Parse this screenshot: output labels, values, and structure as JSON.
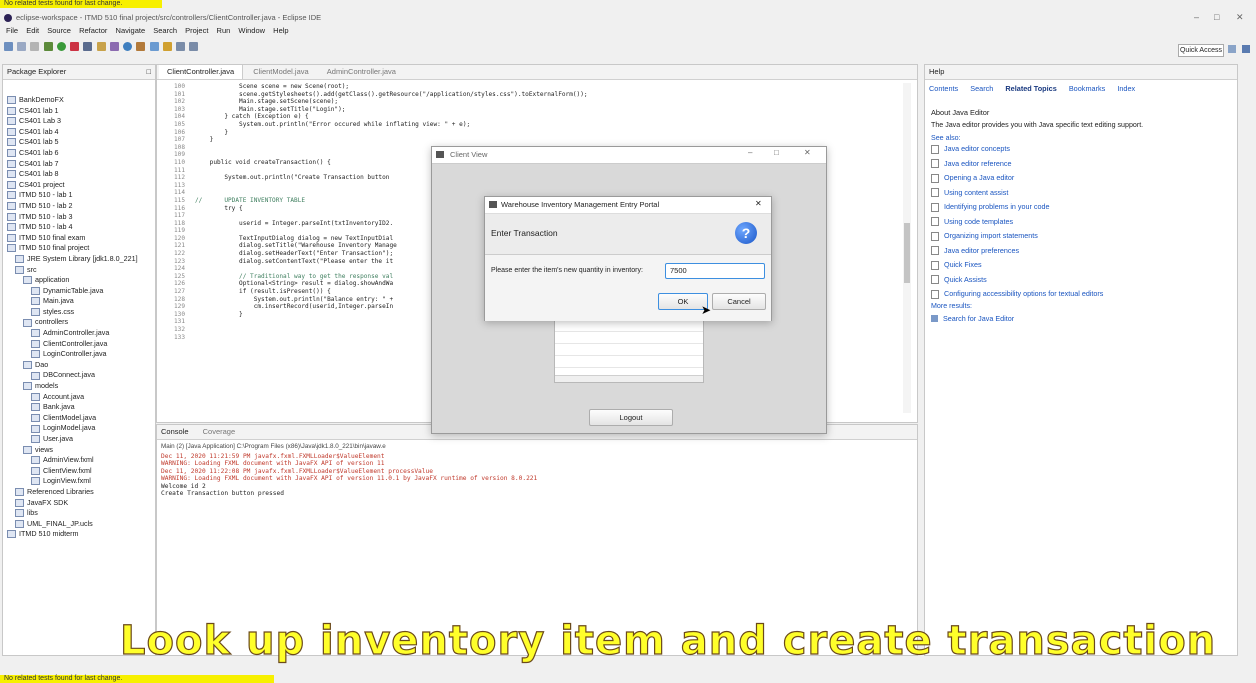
{
  "top_status": "No related tests found for last change.",
  "bottom_status": "No related tests found for last change.",
  "window_title": "eclipse-workspace - ITMD 510 final project/src/controllers/ClientController.java - Eclipse IDE",
  "menu": [
    "File",
    "Edit",
    "Source",
    "Refactor",
    "Navigate",
    "Search",
    "Project",
    "Run",
    "Window",
    "Help"
  ],
  "quick_access": "Quick Access",
  "package_explorer": {
    "title": "Package Explorer",
    "items": [
      {
        "label": "BankDemoFX",
        "indent": 0
      },
      {
        "label": "CS401 lab 1",
        "indent": 0
      },
      {
        "label": "CS401 Lab 3",
        "indent": 0
      },
      {
        "label": "CS401 lab 4",
        "indent": 0
      },
      {
        "label": "CS401 lab 5",
        "indent": 0
      },
      {
        "label": "CS401 lab 6",
        "indent": 0
      },
      {
        "label": "CS401 lab 7",
        "indent": 0
      },
      {
        "label": "CS401 lab 8",
        "indent": 0
      },
      {
        "label": "CS401 project",
        "indent": 0
      },
      {
        "label": "ITMD 510 - lab 1",
        "indent": 0
      },
      {
        "label": "ITMD 510 - lab 2",
        "indent": 0
      },
      {
        "label": "ITMD 510 - lab 3",
        "indent": 0
      },
      {
        "label": "ITMD 510 - lab 4",
        "indent": 0
      },
      {
        "label": "ITMD 510 final exam",
        "indent": 0
      },
      {
        "label": "ITMD 510 final project",
        "indent": 0
      },
      {
        "label": "JRE System Library [jdk1.8.0_221]",
        "indent": 1
      },
      {
        "label": "src",
        "indent": 1
      },
      {
        "label": "application",
        "indent": 2
      },
      {
        "label": "DynamicTable.java",
        "indent": 3
      },
      {
        "label": "Main.java",
        "indent": 3
      },
      {
        "label": "styles.css",
        "indent": 3
      },
      {
        "label": "controllers",
        "indent": 2
      },
      {
        "label": "AdminController.java",
        "indent": 3
      },
      {
        "label": "ClientController.java",
        "indent": 3
      },
      {
        "label": "LoginController.java",
        "indent": 3
      },
      {
        "label": "Dao",
        "indent": 2
      },
      {
        "label": "DBConnect.java",
        "indent": 3
      },
      {
        "label": "models",
        "indent": 2
      },
      {
        "label": "Account.java",
        "indent": 3
      },
      {
        "label": "Bank.java",
        "indent": 3
      },
      {
        "label": "ClientModel.java",
        "indent": 3
      },
      {
        "label": "LoginModel.java",
        "indent": 3
      },
      {
        "label": "User.java",
        "indent": 3
      },
      {
        "label": "views",
        "indent": 2
      },
      {
        "label": "AdminView.fxml",
        "indent": 3
      },
      {
        "label": "ClientView.fxml",
        "indent": 3
      },
      {
        "label": "LoginView.fxml",
        "indent": 3
      },
      {
        "label": "Referenced Libraries",
        "indent": 1
      },
      {
        "label": "JavaFX SDK",
        "indent": 1
      },
      {
        "label": "libs",
        "indent": 1
      },
      {
        "label": "UML_FINAL_JP.ucls",
        "indent": 1
      },
      {
        "label": "ITMD 510 midterm",
        "indent": 0
      }
    ]
  },
  "editor_tabs": [
    "ClientController.java",
    "ClientModel.java",
    "AdminController.java"
  ],
  "code_lines": [
    {
      "n": "100",
      "t": "            Scene scene = new Scene(root);"
    },
    {
      "n": "101",
      "t": "            scene.getStylesheets().add(getClass().getResource(\"/application/styles.css\").toExternalForm());"
    },
    {
      "n": "102",
      "t": "            Main.stage.setScene(scene);"
    },
    {
      "n": "103",
      "t": "            Main.stage.setTitle(\"Login\");"
    },
    {
      "n": "104",
      "t": "        } catch (Exception e) {"
    },
    {
      "n": "105",
      "t": "            System.out.println(\"Error occured while inflating view: \" + e);"
    },
    {
      "n": "106",
      "t": "        }"
    },
    {
      "n": "107",
      "t": "    }"
    },
    {
      "n": "108",
      "t": ""
    },
    {
      "n": "109",
      "t": ""
    },
    {
      "n": "110",
      "t": "    public void createTransaction() {"
    },
    {
      "n": "111",
      "t": ""
    },
    {
      "n": "112",
      "t": "        System.out.println(\"Create Transaction button"
    },
    {
      "n": "113",
      "t": ""
    },
    {
      "n": "114",
      "t": ""
    },
    {
      "n": "115",
      "t": "//      UPDATE INVENTORY TABLE"
    },
    {
      "n": "116",
      "t": "        try {"
    },
    {
      "n": "117",
      "t": ""
    },
    {
      "n": "118",
      "t": "            userid = Integer.parseInt(txtInventoryID2."
    },
    {
      "n": "119",
      "t": ""
    },
    {
      "n": "120",
      "t": "            TextInputDialog dialog = new TextInputDial"
    },
    {
      "n": "121",
      "t": "            dialog.setTitle(\"Warehouse Inventory Manage"
    },
    {
      "n": "122",
      "t": "            dialog.setHeaderText(\"Enter Transaction\");"
    },
    {
      "n": "123",
      "t": "            dialog.setContentText(\"Please enter the it"
    },
    {
      "n": "124",
      "t": ""
    },
    {
      "n": "125",
      "t": "            // Traditional way to get the response val"
    },
    {
      "n": "126",
      "t": "            Optional<String> result = dialog.showAndWa"
    },
    {
      "n": "127",
      "t": "            if (result.isPresent()) {"
    },
    {
      "n": "128",
      "t": "                System.out.println(\"Balance entry: \" +"
    },
    {
      "n": "129",
      "t": "                cm.insertRecord(userid,Integer.parseIn"
    },
    {
      "n": "130",
      "t": "            }"
    },
    {
      "n": "131",
      "t": ""
    },
    {
      "n": "132",
      "t": ""
    },
    {
      "n": "133",
      "t": ""
    }
  ],
  "console": {
    "tabs": [
      "Console",
      "Coverage"
    ],
    "header": "Main (2) [Java Application] C:\\Program Files (x86)\\Java\\jdk1.8.0_221\\bin\\javaw.e",
    "lines": [
      {
        "t": "Dec 11, 2020 11:21:59 PM javafx.fxml.FXMLLoader$ValueElement",
        "c": "#c0392b"
      },
      {
        "t": "WARNING: Loading FXML document with JavaFX API of version 11",
        "c": "#c0392b"
      },
      {
        "t": "Dec 11, 2020 11:22:08 PM javafx.fxml.FXMLLoader$ValueElement processValue",
        "c": "#c0392b"
      },
      {
        "t": "WARNING: Loading FXML document with JavaFX API of version 11.0.1 by JavaFX runtime of version 8.0.221",
        "c": "#c0392b"
      },
      {
        "t": "Welcome id 2",
        "c": "#222222"
      },
      {
        "t": "Create Transaction button pressed",
        "c": "#222222"
      }
    ]
  },
  "help": {
    "title": "Help",
    "tabs": [
      "Contents",
      "Search",
      "Related Topics",
      "Bookmarks",
      "Index"
    ],
    "about_title": "About Java Editor",
    "about_text": "The Java editor provides you with Java specific text editing support.",
    "see_also": "See also:",
    "links": [
      "Java editor concepts",
      "Java editor reference",
      "Opening a Java editor",
      "Using content assist",
      "Identifying problems in your code",
      "Using code templates",
      "Organizing import statements",
      "Java editor preferences",
      "Quick Fixes",
      "Quick Assists",
      "Configuring accessibility options for textual editors"
    ],
    "more_results": "More results:",
    "search_link": "Search for Java Editor"
  },
  "client_view": {
    "title": "Client View",
    "logout": "Logout"
  },
  "dialog": {
    "title": "Warehouse Inventory Management Entry Portal",
    "header": "Enter Transaction",
    "prompt": "Please enter the item's new quantity in inventory:",
    "value": "7500",
    "ok": "OK",
    "cancel": "Cancel"
  },
  "caption": "Look up inventory item and create transaction"
}
